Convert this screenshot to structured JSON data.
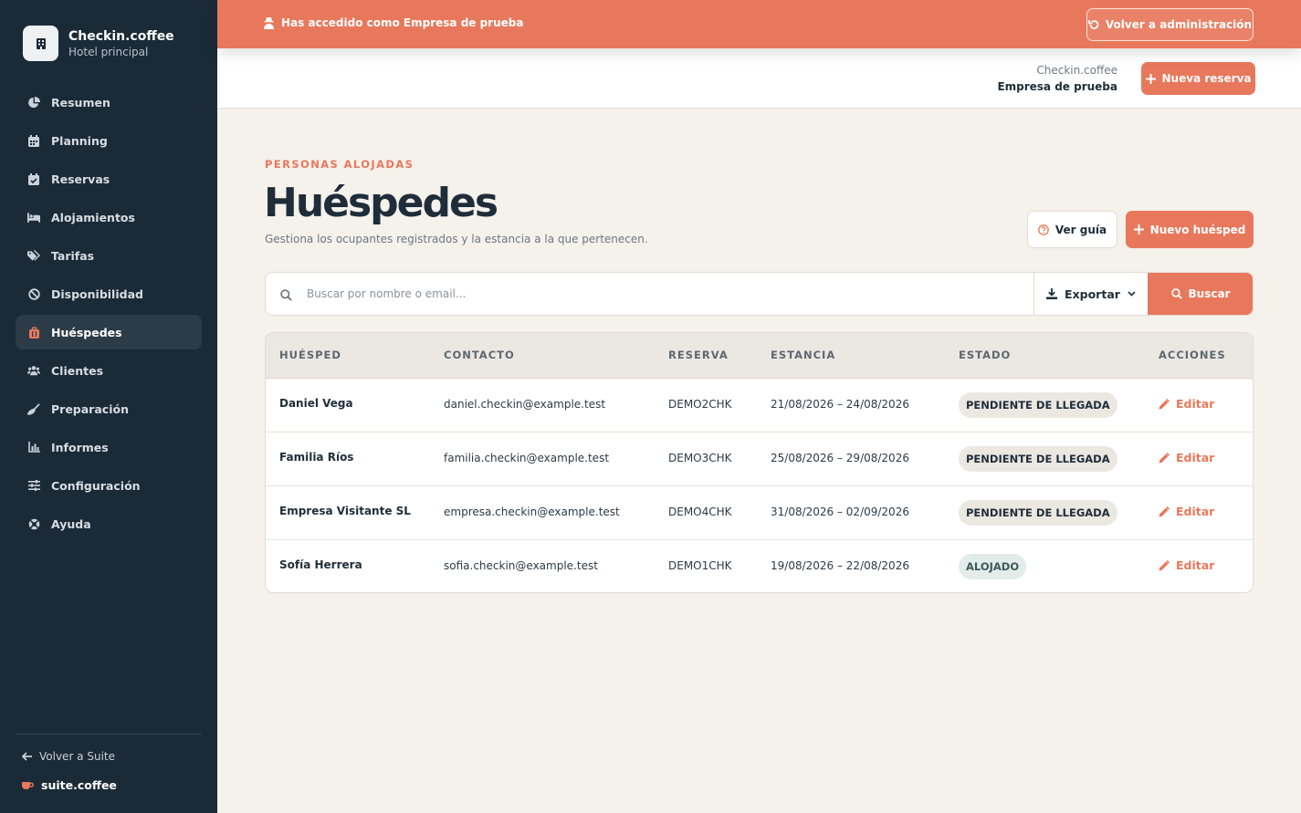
{
  "sidebar": {
    "brand_name": "Checkin.coffee",
    "brand_sub": "Hotel principal",
    "items": [
      {
        "label": "Resumen",
        "icon": "pie-chart-icon"
      },
      {
        "label": "Planning",
        "icon": "calendar-icon"
      },
      {
        "label": "Reservas",
        "icon": "calendar-check-icon"
      },
      {
        "label": "Alojamientos",
        "icon": "bed-icon"
      },
      {
        "label": "Tarifas",
        "icon": "tags-icon"
      },
      {
        "label": "Disponibilidad",
        "icon": "ban-icon"
      },
      {
        "label": "Huéspedes",
        "icon": "suitcase-icon",
        "active": true
      },
      {
        "label": "Clientes",
        "icon": "users-icon"
      },
      {
        "label": "Preparación",
        "icon": "broom-icon"
      },
      {
        "label": "Informes",
        "icon": "bar-chart-icon"
      },
      {
        "label": "Configuración",
        "icon": "sliders-icon"
      },
      {
        "label": "Ayuda",
        "icon": "lifebuoy-icon"
      }
    ],
    "back_label": "Volver a Suite",
    "suite_brand": "suite.coffee"
  },
  "banner": {
    "message": "Has accedido como Empresa de prueba",
    "button": "Volver a administración"
  },
  "header": {
    "brand_line1": "Checkin.coffee",
    "brand_line2": "Empresa de prueba",
    "new_booking": "Nueva reserva"
  },
  "page": {
    "eyebrow": "PERSONAS ALOJADAS",
    "title": "Huéspedes",
    "subtitle": "Gestiona los ocupantes registrados y la estancia a la que pertenecen.",
    "guide_button": "Ver guía",
    "new_guest_button": "Nuevo huésped"
  },
  "search": {
    "placeholder": "Buscar por nombre o email...",
    "value": "",
    "export_label": "Exportar",
    "search_label": "Buscar"
  },
  "table": {
    "columns": [
      "HUÉSPED",
      "CONTACTO",
      "RESERVA",
      "ESTANCIA",
      "ESTADO",
      "ACCIONES"
    ],
    "edit_label": "Editar",
    "rows": [
      {
        "name": "Daniel Vega",
        "email": "daniel.checkin@example.test",
        "booking": "DEMO2CHK",
        "stay": "21/08/2026 – 24/08/2026",
        "status": "PENDIENTE DE LLEGADA"
      },
      {
        "name": "Familia Ríos",
        "email": "familia.checkin@example.test",
        "booking": "DEMO3CHK",
        "stay": "25/08/2026 – 29/08/2026",
        "status": "PENDIENTE DE LLEGADA"
      },
      {
        "name": "Empresa Visitante SL",
        "email": "empresa.checkin@example.test",
        "booking": "DEMO4CHK",
        "stay": "31/08/2026 – 02/09/2026",
        "status": "PENDIENTE DE LLEGADA"
      },
      {
        "name": "Sofía Herrera",
        "email": "sofia.checkin@example.test",
        "booking": "DEMO1CHK",
        "stay": "19/08/2026 – 22/08/2026",
        "status": "ALOJADO"
      }
    ]
  },
  "colors": {
    "accent": "#e8785c",
    "sidebar_bg": "#1b2a37",
    "page_bg": "#f5f1eb"
  }
}
